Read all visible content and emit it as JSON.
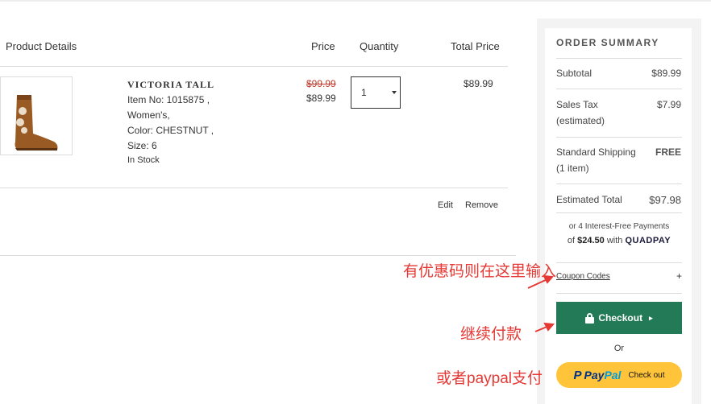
{
  "table": {
    "headers": {
      "product": "Product Details",
      "price": "Price",
      "quantity": "Quantity",
      "total": "Total Price"
    }
  },
  "item": {
    "name": "VICTORIA TALL",
    "item_no": "Item No: 1015875 ,",
    "gender": "Women's,",
    "color": "Color: CHESTNUT ,",
    "size": "Size: 6",
    "stock": "In Stock",
    "original_price": "$99.99",
    "sale_price": "$89.99",
    "quantity": "1",
    "total": "$89.99",
    "edit_label": "Edit",
    "remove_label": "Remove"
  },
  "summary": {
    "title": "ORDER SUMMARY",
    "subtotal_label": "Subtotal",
    "subtotal": "$89.99",
    "tax_label_1": "Sales Tax",
    "tax_label_2": "(estimated)",
    "tax": "$7.99",
    "shipping_label_1": "Standard Shipping",
    "shipping_label_2": "(1 item)",
    "shipping": "FREE",
    "total_label": "Estimated Total",
    "total": "$97.98",
    "installments_line1": "or 4 Interest-Free Payments",
    "installments_prefix": "of",
    "installment_amount": "$24.50",
    "installments_with": "with",
    "quadpay": "QUADPAY",
    "coupon_label": "Coupon Codes",
    "coupon_toggle": "+",
    "checkout_label": "Checkout",
    "or_label": "Or",
    "paypal_p": "P",
    "paypal_pay": "Pay",
    "paypal_pal": "Pal",
    "paypal_checkout": "Check out"
  },
  "annotations": {
    "coupon_hint": "有优惠码则在这里输入",
    "checkout_hint": "继续付款",
    "paypal_hint": "或者paypal支付"
  },
  "colors": {
    "checkout_green": "#237a57",
    "paypal_yellow": "#ffc439",
    "annotation_red": "#e53935",
    "strike_red": "#c0392b"
  },
  "icons": [
    "lock-icon",
    "chevron-right-icon",
    "dropdown-caret-icon",
    "annotation-arrow-icon"
  ]
}
